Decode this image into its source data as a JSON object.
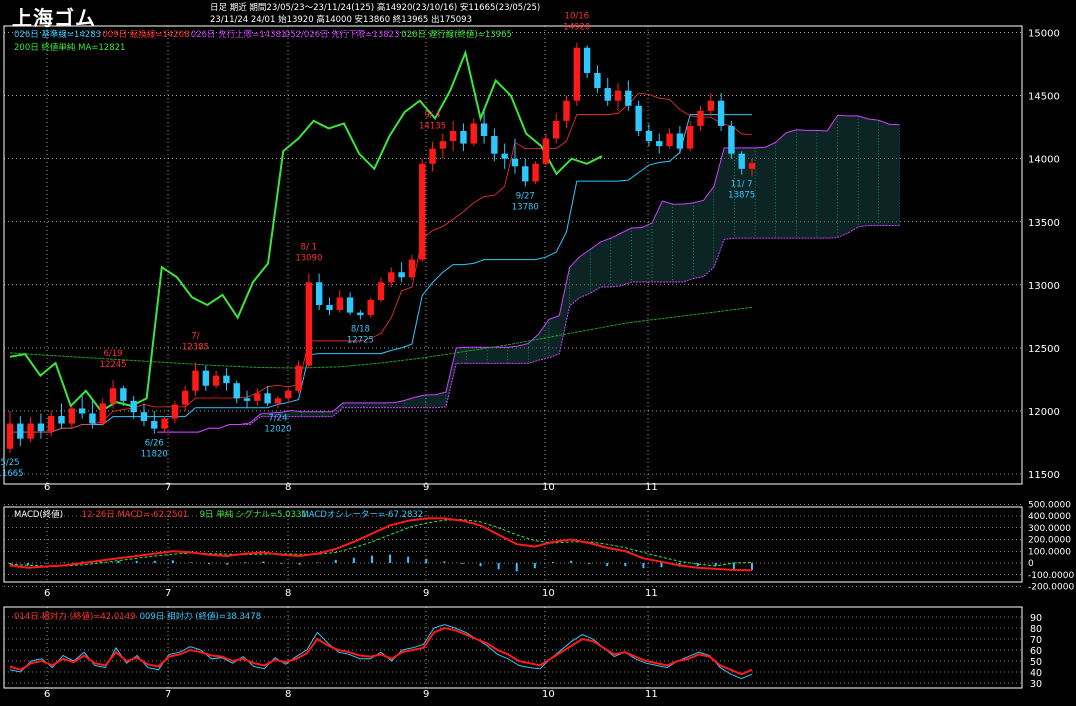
{
  "header": {
    "title": "上海ゴム",
    "line1a": "日足  期近",
    "line1b": "期間23/05/23～23/11/24(125) 高14920(23/10/16) 安11665(23/05/25)",
    "line2": "23/11/24 24/01 始13920 高14000 安13860 終13965 出175093"
  },
  "legend_main": [
    {
      "text": "026日 基準線=14283",
      "color": "#2ec8ff"
    },
    {
      "text": "009日 転換線=14208",
      "color": "#ff3030"
    },
    {
      "text": "026日 先行上限=14381",
      "color": "#d040ff"
    },
    {
      "text": "052/026日 先行下限=13823",
      "color": "#d040ff"
    },
    {
      "text": "026日 遅行線(終値)=13965",
      "color": "#39e639"
    }
  ],
  "legend_main2": {
    "text": "200日 終値単純 MA=12821",
    "color": "#39e639"
  },
  "legend_macd": [
    {
      "text": "MACD(終値)",
      "color": "#ffffff"
    },
    {
      "text": "12-26日 MACD=-62.2501",
      "color": "#ff3030"
    },
    {
      "text": "9日 単純 シグナル=5.0331",
      "color": "#39e639"
    },
    {
      "text": "MACDオシレーター=-67.2832",
      "color": "#2ec8ff"
    }
  ],
  "legend_rsi": [
    {
      "text": "014日 相対力 (終値)=42.0149",
      "color": "#ff3030"
    },
    {
      "text": "009日 相対力 (終値)=38.3478",
      "color": "#2ec8ff"
    }
  ],
  "colors": {
    "up": "#ff1a1a",
    "down": "#2ec8ff",
    "kijun": "#2ec8ff",
    "tenkan": "#ff3030",
    "chikou": "#39e639",
    "kumo": "#d040ff",
    "ma200": "#22a022",
    "grid": "#ffffff"
  },
  "month_labels": [
    "6",
    "7",
    "8",
    "9",
    "10",
    "11"
  ],
  "annotations": [
    {
      "text": "5/25",
      "sub": "11665",
      "color": "#2ec8ff"
    },
    {
      "text": "6/19",
      "sub": "12245",
      "color": "#ff3030"
    },
    {
      "text": "6/26",
      "sub": "11820",
      "color": "#2ec8ff"
    },
    {
      "text": "7/",
      "sub": "12385",
      "color": "#ff3030"
    },
    {
      "text": "7/24",
      "sub": "12020",
      "color": "#2ec8ff"
    },
    {
      "text": "8/ 1",
      "sub": "13090",
      "color": "#ff3030"
    },
    {
      "text": "8/18",
      "sub": "12725",
      "color": "#2ec8ff"
    },
    {
      "text": "9/ 4",
      "sub": "14135",
      "color": "#ff3030"
    },
    {
      "text": "9/27",
      "sub": "13780",
      "color": "#2ec8ff"
    },
    {
      "text": "10/16",
      "sub": "14920",
      "color": "#ff3030"
    },
    {
      "text": "11/ 7",
      "sub": "13875",
      "color": "#2ec8ff"
    }
  ],
  "chart_data": [
    {
      "type": "candlestick",
      "title": "上海ゴム 日足 期近",
      "ylim": [
        11500,
        15100
      ],
      "yticks": [
        11500,
        12000,
        12500,
        13000,
        13500,
        14000,
        14500,
        15000
      ],
      "x_months": [
        "6",
        "7",
        "8",
        "9",
        "10",
        "11"
      ],
      "ohlc": [
        [
          11700,
          12000,
          11665,
          11900
        ],
        [
          11900,
          11960,
          11720,
          11780
        ],
        [
          11780,
          11950,
          11750,
          11900
        ],
        [
          11900,
          11980,
          11780,
          11840
        ],
        [
          11840,
          12000,
          11800,
          11960
        ],
        [
          11960,
          12060,
          11860,
          11900
        ],
        [
          11900,
          12040,
          11860,
          12020
        ],
        [
          12020,
          12120,
          11940,
          11980
        ],
        [
          11980,
          12080,
          11860,
          11900
        ],
        [
          11900,
          12100,
          11880,
          12060
        ],
        [
          12060,
          12245,
          12020,
          12180
        ],
        [
          12180,
          12200,
          12040,
          12080
        ],
        [
          12080,
          12120,
          11940,
          11990
        ],
        [
          11990,
          12060,
          11880,
          11920
        ],
        [
          11920,
          12000,
          11820,
          11860
        ],
        [
          11860,
          11960,
          11830,
          11940
        ],
        [
          11940,
          12080,
          11900,
          12050
        ],
        [
          12050,
          12200,
          12000,
          12160
        ],
        [
          12160,
          12385,
          12120,
          12320
        ],
        [
          12320,
          12360,
          12160,
          12200
        ],
        [
          12200,
          12320,
          12180,
          12280
        ],
        [
          12280,
          12340,
          12160,
          12220
        ],
        [
          12220,
          12240,
          12060,
          12100
        ],
        [
          12100,
          12160,
          12020,
          12080
        ],
        [
          12080,
          12180,
          12040,
          12140
        ],
        [
          12140,
          12200,
          12040,
          12060
        ],
        [
          12060,
          12120,
          12020,
          12100
        ],
        [
          12100,
          12180,
          12060,
          12160
        ],
        [
          12160,
          12400,
          12140,
          12360
        ],
        [
          12360,
          13090,
          12340,
          13020
        ],
        [
          13020,
          13090,
          12800,
          12840
        ],
        [
          12840,
          12900,
          12760,
          12800
        ],
        [
          12800,
          12960,
          12780,
          12900
        ],
        [
          12900,
          12940,
          12760,
          12780
        ],
        [
          12780,
          12800,
          12725,
          12760
        ],
        [
          12760,
          12900,
          12740,
          12880
        ],
        [
          12880,
          13060,
          12860,
          13020
        ],
        [
          13020,
          13140,
          12980,
          13100
        ],
        [
          13100,
          13180,
          13020,
          13060
        ],
        [
          13060,
          13240,
          13040,
          13200
        ],
        [
          13200,
          14000,
          13180,
          13960
        ],
        [
          13960,
          14135,
          13900,
          14080
        ],
        [
          14080,
          14200,
          14000,
          14140
        ],
        [
          14140,
          14300,
          14060,
          14220
        ],
        [
          14220,
          14280,
          14060,
          14120
        ],
        [
          14120,
          14320,
          14100,
          14280
        ],
        [
          14280,
          14380,
          14120,
          14180
        ],
        [
          14180,
          14240,
          13980,
          14040
        ],
        [
          14040,
          14120,
          13920,
          14000
        ],
        [
          14000,
          14160,
          13880,
          13940
        ],
        [
          13940,
          14000,
          13780,
          13820
        ],
        [
          13820,
          13980,
          13800,
          13960
        ],
        [
          13960,
          14200,
          13940,
          14160
        ],
        [
          14160,
          14360,
          14120,
          14300
        ],
        [
          14300,
          14500,
          14240,
          14460
        ],
        [
          14460,
          14920,
          14420,
          14880
        ],
        [
          14880,
          14900,
          14640,
          14680
        ],
        [
          14680,
          14740,
          14520,
          14560
        ],
        [
          14560,
          14640,
          14420,
          14460
        ],
        [
          14460,
          14600,
          14380,
          14540
        ],
        [
          14540,
          14620,
          14380,
          14420
        ],
        [
          14420,
          14460,
          14180,
          14220
        ],
        [
          14220,
          14280,
          14100,
          14140
        ],
        [
          14140,
          14200,
          14040,
          14100
        ],
        [
          14100,
          14240,
          14080,
          14200
        ],
        [
          14200,
          14260,
          14040,
          14080
        ],
        [
          14080,
          14300,
          14060,
          14260
        ],
        [
          14260,
          14420,
          14220,
          14380
        ],
        [
          14380,
          14520,
          14340,
          14460
        ],
        [
          14460,
          14520,
          14220,
          14260
        ],
        [
          14260,
          14300,
          14000,
          14040
        ],
        [
          14040,
          14060,
          13875,
          13920
        ],
        [
          13920,
          14000,
          13860,
          13965
        ]
      ],
      "series": [
        {
          "name": "200日 終値単純 MA",
          "values": [
            12460,
            12440,
            12420,
            12400,
            12380,
            12360,
            12345,
            12340,
            12350,
            12380,
            12420,
            12470,
            12520,
            12580,
            12640,
            12700,
            12740,
            12780,
            12821
          ]
        },
        {
          "name": "026日 遅行線(終値)",
          "values": [
            12430,
            12450,
            12280,
            12380,
            12040,
            12160,
            12000,
            12070,
            12040,
            12100,
            13140,
            13060,
            12900,
            12840,
            12920,
            12740,
            13020,
            13170,
            14060,
            14160,
            14300,
            14240,
            14280,
            14040,
            13920,
            14180,
            14370,
            14460,
            14320,
            14540,
            14840,
            14320,
            14620,
            14500,
            14200,
            14100,
            13880,
            14000,
            13960,
            14020
          ]
        }
      ]
    },
    {
      "type": "line",
      "title": "MACD(終値)",
      "ylim": [
        -200,
        500
      ],
      "yticks": [
        "500.0000",
        "400.0000",
        "300.0000",
        "200.0000",
        "100.0000",
        "0",
        "-100.0000",
        "-200.0000"
      ],
      "series": [
        {
          "name": "12-26日 MACD",
          "values": [
            -20,
            -40,
            -30,
            -20,
            0,
            20,
            40,
            60,
            80,
            100,
            90,
            70,
            60,
            80,
            90,
            70,
            60,
            80,
            120,
            180,
            250,
            320,
            360,
            380,
            380,
            360,
            320,
            240,
            160,
            140,
            180,
            200,
            170,
            130,
            100,
            40,
            10,
            -20,
            -40,
            -50,
            -60,
            -62
          ]
        },
        {
          "name": "9日 単純 シグナル",
          "values": [
            -10,
            -20,
            -25,
            -25,
            -15,
            0,
            20,
            40,
            60,
            75,
            85,
            80,
            75,
            72,
            75,
            78,
            75,
            75,
            90,
            130,
            180,
            240,
            300,
            340,
            365,
            370,
            350,
            300,
            240,
            190,
            170,
            180,
            180,
            160,
            130,
            90,
            50,
            15,
            -10,
            -25,
            0,
            5
          ]
        }
      ]
    },
    {
      "type": "line",
      "title": "相対力",
      "ylim": [
        30,
        90
      ],
      "yticks": [
        90,
        80,
        70,
        60,
        50,
        40,
        30
      ],
      "series": [
        {
          "name": "014日 相対力 (終値)",
          "values": [
            45,
            42,
            48,
            50,
            46,
            52,
            49,
            55,
            48,
            46,
            58,
            50,
            53,
            47,
            45,
            54,
            56,
            60,
            58,
            55,
            54,
            50,
            52,
            48,
            46,
            51,
            49,
            52,
            57,
            70,
            64,
            60,
            58,
            55,
            54,
            56,
            52,
            58,
            60,
            62,
            76,
            80,
            78,
            74,
            70,
            66,
            60,
            56,
            50,
            48,
            46,
            52,
            58,
            64,
            70,
            68,
            62,
            56,
            58,
            54,
            50,
            48,
            46,
            50,
            52,
            56,
            54,
            46,
            42,
            38,
            42
          ]
        },
        {
          "name": "009日 相対力 (終値)",
          "values": [
            42,
            40,
            50,
            52,
            44,
            55,
            50,
            58,
            46,
            44,
            62,
            48,
            55,
            44,
            42,
            56,
            58,
            63,
            60,
            52,
            53,
            48,
            54,
            45,
            43,
            53,
            47,
            54,
            60,
            76,
            66,
            58,
            56,
            52,
            52,
            58,
            50,
            60,
            62,
            65,
            80,
            83,
            80,
            76,
            70,
            64,
            56,
            52,
            46,
            44,
            43,
            52,
            60,
            68,
            74,
            70,
            62,
            54,
            58,
            52,
            48,
            46,
            44,
            50,
            54,
            58,
            55,
            44,
            38,
            34,
            38
          ]
        }
      ]
    }
  ]
}
